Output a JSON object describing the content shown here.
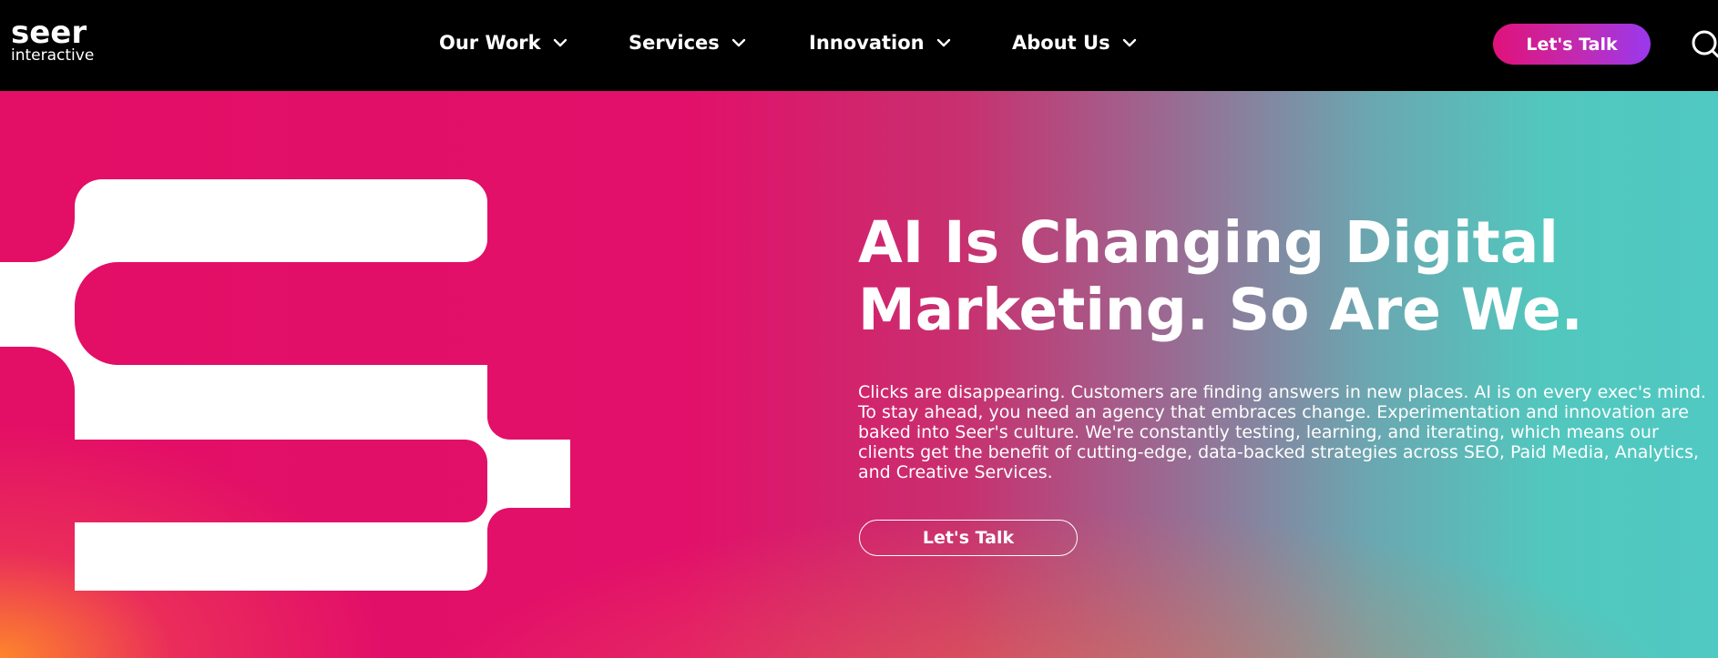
{
  "brand": {
    "logo_main": "seer",
    "logo_sub": "interactive"
  },
  "nav": {
    "items": [
      {
        "label": "Our Work",
        "icon": "chevron-down-icon"
      },
      {
        "label": "Services",
        "icon": "chevron-down-icon"
      },
      {
        "label": "Innovation",
        "icon": "chevron-down-icon"
      },
      {
        "label": "About Us",
        "icon": "chevron-down-icon"
      }
    ],
    "cta_label": "Let's Talk",
    "search_icon": "search-icon"
  },
  "hero": {
    "headline_line1": "AI Is Changing Digital",
    "headline_line2": "Marketing. So Are We.",
    "body": "Clicks are disappearing. Customers are finding answers in new places. AI is on every exec's mind. To stay ahead, you need an agency that embraces change. Experimentation and innovation are baked into Seer's culture. We're constantly testing, learning, and iterating, which means our clients get the benefit of cutting-edge, data-backed strategies across SEO, Paid Media, Analytics, and Creative Services.",
    "cta_label": "Let's Talk",
    "graphic": "seer-s-mark-graphic"
  },
  "colors": {
    "nav_background": "#000000",
    "cta_gradient_start": "#e0127a",
    "cta_gradient_end": "#9a38ee",
    "hero_pink": "#e30e66",
    "hero_teal": "#4fc9c2",
    "hero_orange": "#ff8c28",
    "text": "#ffffff"
  }
}
